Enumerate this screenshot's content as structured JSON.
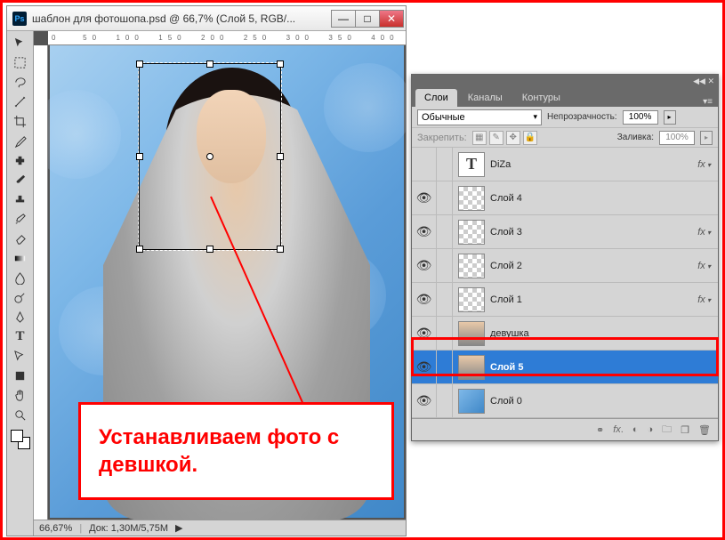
{
  "doc": {
    "title": "шаблон для фотошопа.psd @ 66,7% (Слой 5, RGB/...",
    "zoom": "66,67%",
    "docsize": "Док: 1,30M/5,75M"
  },
  "annotation": {
    "text": "Устанавливаем фото с девшкой."
  },
  "panel": {
    "tabs": {
      "layers": "Слои",
      "channels": "Каналы",
      "paths": "Контуры"
    },
    "blend_mode": "Обычные",
    "opacity_label": "Непрозрачность:",
    "opacity_value": "100%",
    "lock_label": "Закрепить:",
    "fill_label": "Заливка:",
    "fill_value": "100%"
  },
  "layers": [
    {
      "name": "DiZa",
      "visible": false,
      "type": "text",
      "fx": true
    },
    {
      "name": "Слой 4",
      "visible": true,
      "type": "normal",
      "fx": false
    },
    {
      "name": "Слой 3",
      "visible": true,
      "type": "normal",
      "fx": true
    },
    {
      "name": "Слой 2",
      "visible": true,
      "type": "normal",
      "fx": true
    },
    {
      "name": "Слой 1",
      "visible": true,
      "type": "normal",
      "fx": true
    },
    {
      "name": "девушка",
      "visible": true,
      "type": "img",
      "fx": false
    },
    {
      "name": "Слой 5",
      "visible": true,
      "type": "img",
      "fx": false,
      "selected": true
    },
    {
      "name": "Слой 0",
      "visible": true,
      "type": "bg",
      "fx": false
    }
  ],
  "tools": [
    "move",
    "marquee",
    "lasso",
    "wand",
    "crop",
    "eyedropper",
    "heal",
    "brush",
    "stamp",
    "history",
    "eraser",
    "gradient",
    "blur",
    "dodge",
    "pen",
    "type",
    "path",
    "rect",
    "hand",
    "zoom"
  ]
}
